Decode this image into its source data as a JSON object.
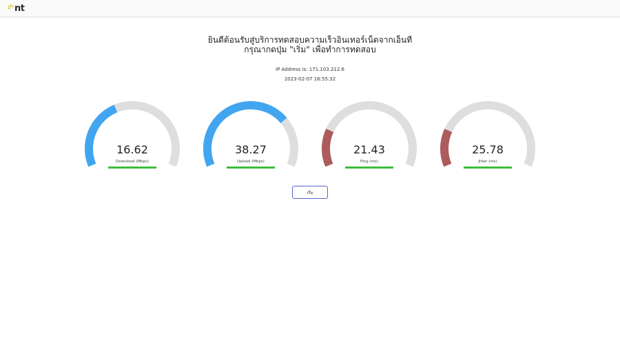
{
  "brand": {
    "logo_text": "nt"
  },
  "heading": {
    "line1": "ยินดีต้อนรับสู่บริการทดสอบความเร็วอินเทอร์เน็ตจากเอ็นที",
    "line2": "กรุณากดปุ่ม \"เริ่ม\" เพื่อทำการทดสอบ"
  },
  "info": {
    "ip": "IP Address is: 171.103.212.6",
    "datetime": "2023-02-07 16:55:32"
  },
  "colors": {
    "blue": "#42a5f0",
    "red": "#ad5b5d",
    "track": "#dedede",
    "green": "#3cbb3c",
    "button_border": "#5b62c7"
  },
  "gauges": [
    {
      "value": "16.62",
      "label": "Download (Mbps)",
      "fill": 0.4,
      "color": "blue"
    },
    {
      "value": "38.27",
      "label": "Upload (Mbps)",
      "fill": 0.72,
      "color": "blue"
    },
    {
      "value": "21.43",
      "label": "Ping (ms)",
      "fill": 0.21,
      "color": "red"
    },
    {
      "value": "25.78",
      "label": "Jitter (ms)",
      "fill": 0.21,
      "color": "red"
    }
  ],
  "start_button": {
    "label": "เริ่ม"
  }
}
